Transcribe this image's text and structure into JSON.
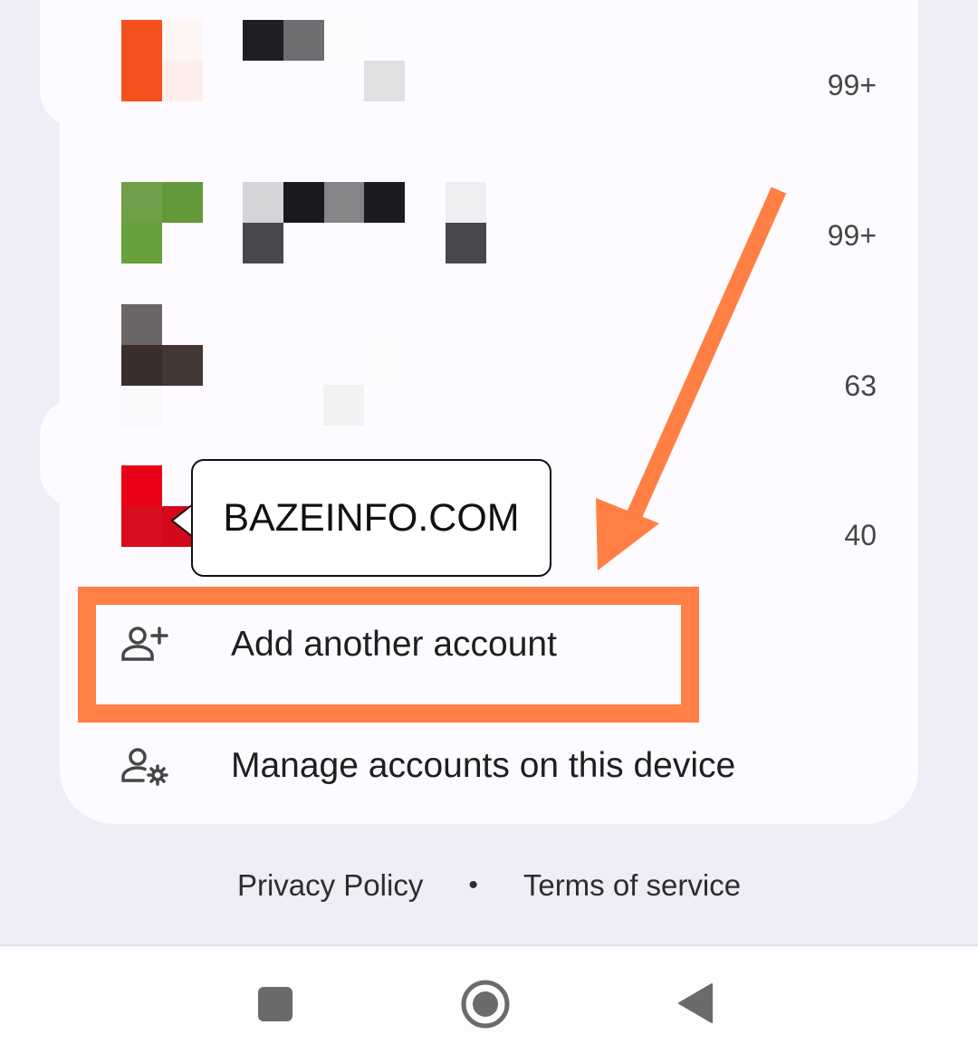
{
  "accounts": [
    {
      "count": "99+",
      "avatar_color": "#f4511e"
    },
    {
      "count": "99+",
      "avatar_color": "#689f38"
    },
    {
      "count": "63",
      "avatar_color": "#3e2f2c"
    },
    {
      "count": "40",
      "avatar_color": "#d50000"
    }
  ],
  "menu": {
    "add_account": {
      "label": "Add another account",
      "icon": "person-add-icon"
    },
    "manage_accounts": {
      "label": "Manage accounts on this device",
      "icon": "manage-accounts-icon"
    }
  },
  "watermark": {
    "text": "BAZEINFO.COM"
  },
  "footer": {
    "privacy": "Privacy Policy",
    "separator": "•",
    "terms": "Terms of service"
  },
  "annotation": {
    "color": "#ff7f44"
  },
  "navbar": {
    "recents": "square-icon",
    "home": "circle-home-icon",
    "back": "triangle-back-icon"
  }
}
